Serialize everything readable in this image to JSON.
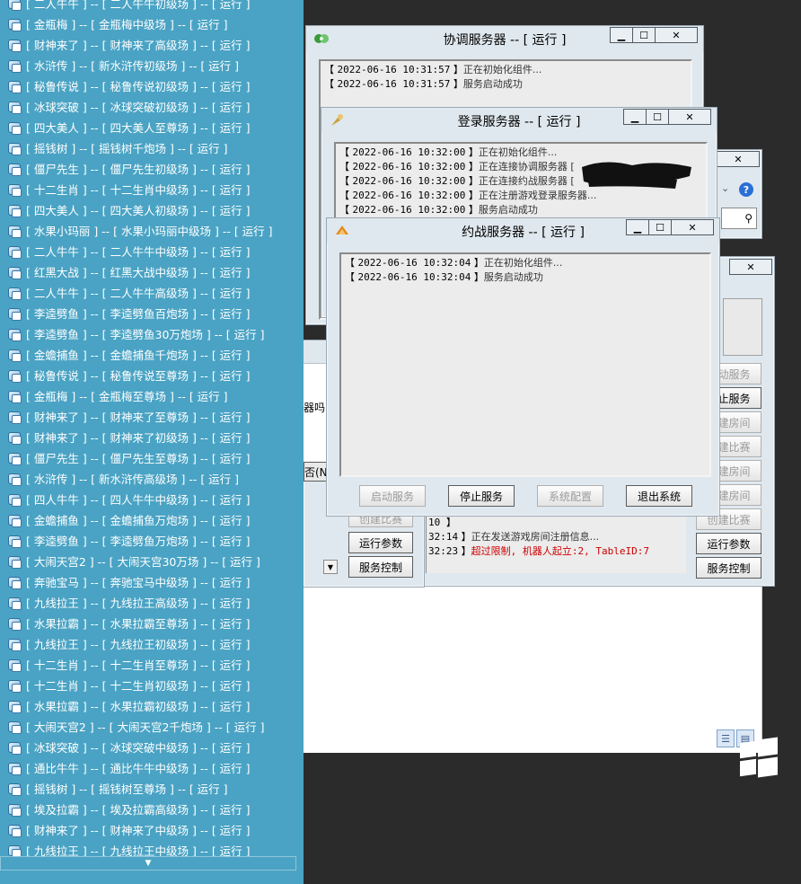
{
  "taskbar": {
    "items": [
      "[ 二人牛牛 ] -- [ 二人牛牛初级场 ] -- [ 运行 ]",
      "[ 金瓶梅 ] -- [ 金瓶梅中级场 ] -- [ 运行 ]",
      "[ 财神来了 ] -- [ 财神来了高级场 ] -- [ 运行 ]",
      "[ 水浒传 ] -- [ 新水浒传初级场 ] -- [ 运行 ]",
      "[ 秘鲁传说 ] -- [ 秘鲁传说初级场 ] -- [ 运行 ]",
      "[ 冰球突破 ] -- [ 冰球突破初级场 ] -- [ 运行 ]",
      "[ 四大美人 ] -- [ 四大美人至尊场 ] -- [ 运行 ]",
      "[ 摇钱树 ] -- [ 摇钱树千炮场 ] -- [ 运行 ]",
      "[ 僵尸先生 ] -- [ 僵尸先生初级场 ] -- [ 运行 ]",
      "[ 十二生肖 ] -- [ 十二生肖中级场 ] -- [ 运行 ]",
      "[ 四大美人 ] -- [ 四大美人初级场 ] -- [ 运行 ]",
      "[ 水果小玛丽 ] -- [ 水果小玛丽中级场 ] -- [ 运行 ]",
      "[ 二人牛牛 ] -- [ 二人牛牛中级场 ] -- [ 运行 ]",
      "[ 红黑大战 ] -- [ 红黑大战中级场 ] -- [ 运行 ]",
      "[ 二人牛牛 ] -- [ 二人牛牛高级场 ] -- [ 运行 ]",
      "[ 李逵劈鱼 ] -- [ 李逵劈鱼百炮场 ] -- [ 运行 ]",
      "[ 李逵劈鱼 ] -- [ 李逵劈鱼30万炮场 ] -- [ 运行 ]",
      "[ 金蟾捕鱼 ] -- [ 金蟾捕鱼千炮场 ] -- [ 运行 ]",
      "[ 秘鲁传说 ] -- [ 秘鲁传说至尊场 ] -- [ 运行 ]",
      "[ 金瓶梅 ] -- [ 金瓶梅至尊场 ] -- [ 运行 ]",
      "[ 财神来了 ] -- [ 财神来了至尊场 ] -- [ 运行 ]",
      "[ 财神来了 ] -- [ 财神来了初级场 ] -- [ 运行 ]",
      "[ 僵尸先生 ] -- [ 僵尸先生至尊场 ] -- [ 运行 ]",
      "[ 水浒传 ] -- [ 新水浒传高级场 ] -- [ 运行 ]",
      "[ 四人牛牛 ] -- [ 四人牛牛中级场 ] -- [ 运行 ]",
      "[ 金蟾捕鱼 ] -- [ 金蟾捕鱼万炮场 ] -- [ 运行 ]",
      "[ 李逵劈鱼 ] -- [ 李逵劈鱼万炮场 ] -- [ 运行 ]",
      "[ 大闹天宫2 ] -- [ 大闹天宫30万场 ] -- [ 运行 ]",
      "[ 奔驰宝马 ] -- [ 奔驰宝马中级场 ] -- [ 运行 ]",
      "[ 九线拉王 ] -- [ 九线拉王高级场 ] -- [ 运行 ]",
      "[ 水果拉霸 ] -- [ 水果拉霸至尊场 ] -- [ 运行 ]",
      "[ 九线拉王 ] -- [ 九线拉王初级场 ] -- [ 运行 ]",
      "[ 十二生肖 ] -- [ 十二生肖至尊场 ] -- [ 运行 ]",
      "[ 十二生肖 ] -- [ 十二生肖初级场 ] -- [ 运行 ]",
      "[ 水果拉霸 ] -- [ 水果拉霸初级场 ] -- [ 运行 ]",
      "[ 大闹天宫2 ] -- [ 大闹天宫2千炮场 ] -- [ 运行 ]",
      "[ 冰球突破 ] -- [ 冰球突破中级场 ] -- [ 运行 ]",
      "[ 通比牛牛 ] -- [ 通比牛牛中级场 ] -- [ 运行 ]",
      "[ 摇钱树 ] -- [ 摇钱树至尊场 ] -- [ 运行 ]",
      "[ 埃及拉霸 ] -- [ 埃及拉霸高级场 ] -- [ 运行 ]",
      "[ 财神来了 ] -- [ 财神来了中级场 ] -- [ 运行 ]",
      "[ 九线拉王 ] -- [ 九线拉王中级场 ] -- [ 运行 ]"
    ]
  },
  "coord_window": {
    "title": "协调服务器 -- [ 运行 ]",
    "logs": [
      {
        "time": "2022-06-16 10:31:57",
        "msg": "正在初始化组件..."
      },
      {
        "time": "2022-06-16 10:31:57",
        "msg": "服务启动成功"
      }
    ]
  },
  "login_window": {
    "title": "登录服务器 -- [ 运行 ]",
    "logs": [
      {
        "time": "2022-06-16 10:32:00",
        "msg": "正在初始化组件..."
      },
      {
        "time": "2022-06-16 10:32:00",
        "msg": "正在连接协调服务器 ["
      },
      {
        "time": "2022-06-16 10:32:00",
        "msg": "正在连接约战服务器 ["
      },
      {
        "time": "2022-06-16 10:32:00",
        "msg": "正在注册游戏登录服务器..."
      },
      {
        "time": "2022-06-16 10:32:00",
        "msg": "服务启动成功"
      }
    ]
  },
  "battle_window": {
    "title": "约战服务器 -- [ 运行 ]",
    "logs": [
      {
        "time": "2022-06-16 10:32:04",
        "msg": "正在初始化组件..."
      },
      {
        "time": "2022-06-16 10:32:04",
        "msg": "服务启动成功"
      }
    ],
    "buttons": {
      "start": "启动服务",
      "stop": "停止服务",
      "config": "系统配置",
      "exit": "退出系统"
    }
  },
  "game_window_left": {
    "partial_text_1": "器吗",
    "partial_text_2": "否(N",
    "log_partial_1": {
      "time": "10",
      "msg": ""
    },
    "log_partial_2": {
      "time": "32:14",
      "msg": "正在发送游戏房间注册信息..."
    },
    "log_partial_3": {
      "time": "32:23",
      "msg": "超过限制, 机器人起立:2, TableID:7"
    },
    "buttons": {
      "match": "创建比赛",
      "params": "运行参数",
      "control": "服务控制"
    }
  },
  "game_window_right": {
    "buttons": {
      "start": "启动服务",
      "stop": "停止服务",
      "create_room": "创建房间",
      "create_match": "创建比赛",
      "create_room2": "创建房间",
      "create_room3": "创建房间",
      "match": "创建比赛",
      "params": "运行参数",
      "control": "服务控制"
    }
  },
  "colors": {
    "taskbar_bg": "#4aa3c4",
    "error_text": "#cc0000"
  }
}
